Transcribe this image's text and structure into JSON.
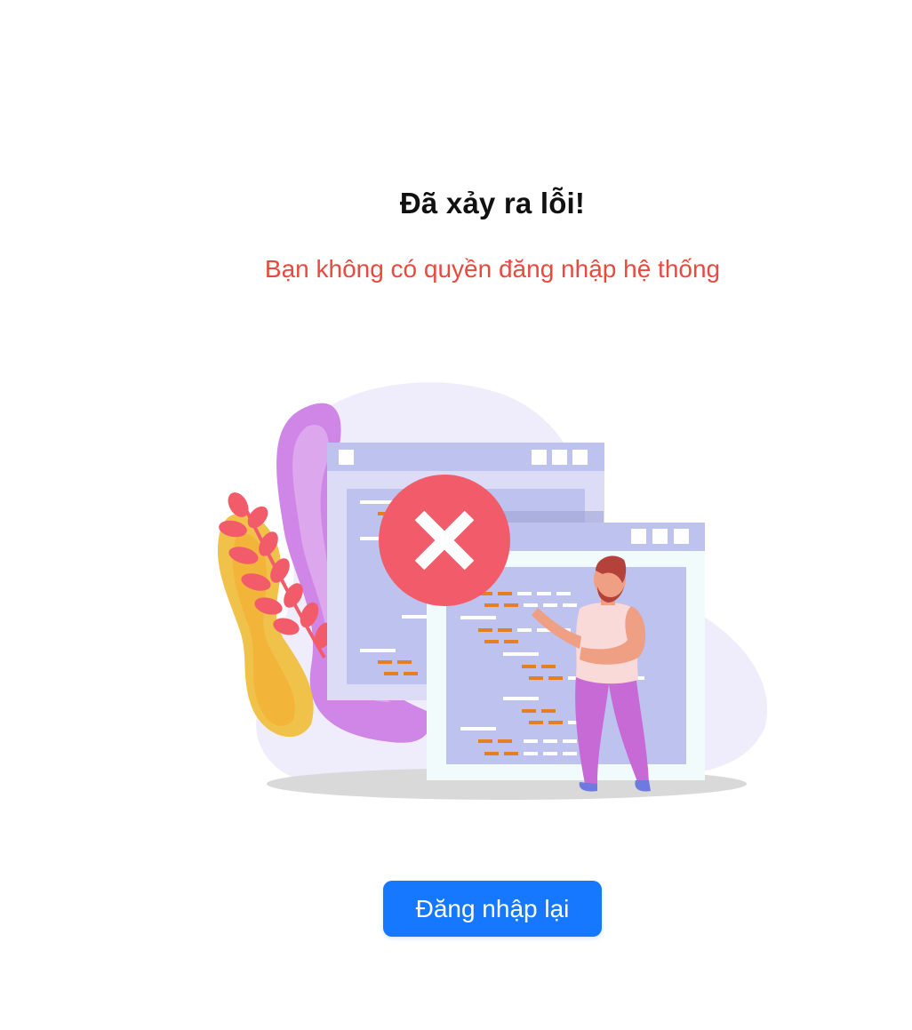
{
  "error": {
    "title": "Đã xảy ra lỗi!",
    "message": "Bạn không có quyền đăng nhập hệ thống"
  },
  "actions": {
    "relogin_label": "Đăng nhập lại"
  },
  "colors": {
    "error_text": "#e74a3f",
    "primary_button": "#1677ff",
    "error_badge": "#f25c6a",
    "blob_purple": "#d9a0ec",
    "window_frame": "#bdc2ee"
  },
  "illustration": {
    "icon": "error-x-icon"
  }
}
